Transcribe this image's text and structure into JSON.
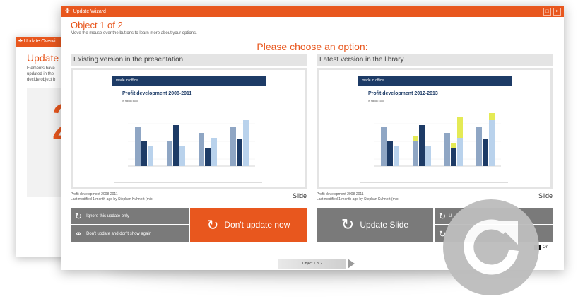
{
  "back_window": {
    "title_bar": "Update Overvi",
    "title": "Update O",
    "desc_lines": [
      "Elements have",
      "updated in the",
      "decide object b"
    ],
    "big_number": "2"
  },
  "window": {
    "title": "Update Wizard",
    "object_title": "Object 1 of 2",
    "hint": "Move the mouse over the buttons to learn more about your options.",
    "choose": "Please choose an option:"
  },
  "left": {
    "header": "Existing version in the presentation",
    "slide_brand": "made in office",
    "slide_title": "Profit development 2008-2011",
    "slide_sub": "in million Euro",
    "meta_name": "Profit development 2008-2011",
    "meta_modified": "Last modified 1 month ago by Stephan Kuhnert (mio",
    "slide_label": "Slide"
  },
  "right": {
    "header": "Latest version in the library",
    "slide_brand": "made in office",
    "slide_title": "Profit development 2012-2013",
    "slide_sub": "in million Euro",
    "meta_name": "Profit development 2008-2011",
    "meta_modified": "Last modified 1 month ago by Stephan Kuhnert (mio",
    "slide_label": "Slide"
  },
  "buttons": {
    "ignore": "Ignore this update only",
    "dont_show": "Don't update and don't show again",
    "dont_update_now": "Don't update now",
    "update_slide": "Update Slide",
    "right_top": "U",
    "right_bottom": ""
  },
  "pager": {
    "label": "Object 1 of 2"
  },
  "toggle": {
    "label": "On"
  },
  "colors": {
    "accent": "#e8571e",
    "button_gray": "#7a7a7a",
    "slide_navy": "#1d3b66"
  }
}
